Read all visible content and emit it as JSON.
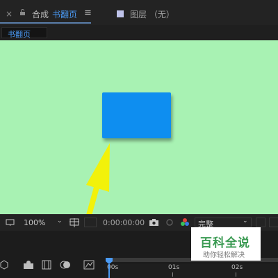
{
  "tabs": {
    "close_glyph": "×",
    "composition_prefix": "合成",
    "composition_name": "书翻页",
    "menu_glyph": "≡",
    "layer_panel": "图层 （无）"
  },
  "subtab": {
    "label": "书翻页"
  },
  "viewer": {
    "background": "#a8f2b3",
    "layer_color": "#0e8ef0"
  },
  "viewer_toolbar": {
    "zoom": "100%",
    "timecode": "0:00:00:00",
    "resolution": "完整"
  },
  "timeline": {
    "ruler_labels": [
      "00s",
      "01s",
      "02s"
    ]
  },
  "watermark": {
    "title": "百科全说",
    "subtitle": "助你轻松解决"
  },
  "colors": {
    "accent": "#4a9af5",
    "arrow": "#f2f20a"
  }
}
